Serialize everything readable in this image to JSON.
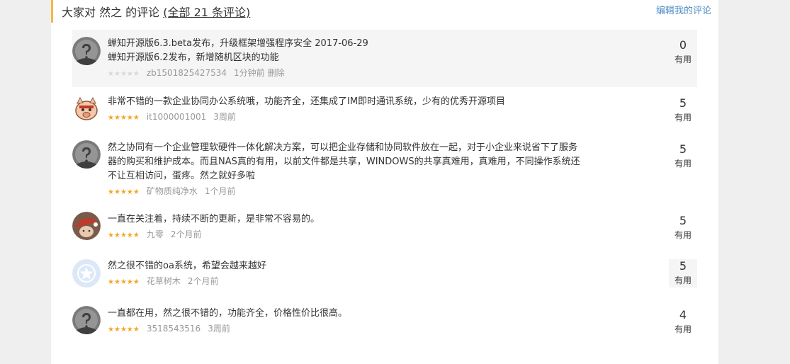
{
  "header": {
    "title_prefix": "大家对 然之 的评论",
    "count_link": "(全部 21 条评论)",
    "edit_link": "编辑我的评论"
  },
  "vote_label": "有用",
  "colors": {
    "star_on": "#f5a623",
    "star_off": "#d8d8d8",
    "accent_bar": "#f4b843",
    "link": "#4a8bc4"
  },
  "comments": [
    {
      "avatar": "default-avatar-icon",
      "lines": [
        "蝉知开源版6.3.beta发布，升级框架增强程序安全 2017-06-29",
        "蝉知开源版6.2发布，新增随机区块的功能"
      ],
      "rating": 0,
      "user": "zb1501825427534",
      "time": "1分钟前",
      "delete": "删除",
      "votes": "0",
      "highlight": true
    },
    {
      "avatar": "pig-avatar-icon",
      "lines": [
        "非常不错的一款企业协同办公系统哦，功能齐全，还集成了IM即时通讯系统，少有的优秀开源项目"
      ],
      "rating": 5,
      "user": "it1000001001",
      "time": "3周前",
      "votes": "5"
    },
    {
      "avatar": "default-avatar-icon",
      "lines": [
        "然之协同有一个企业管理软硬件一体化解决方案，可以把企业存储和协同软件放在一起，对于小企业来说省下了服务",
        "器的购买和维护成本。而且NAS真的有用，以前文件都是共享，WINDOWS的共享真难用，真难用，不同操作系统还",
        "不让互相访问，蛋疼。然之就好多啦"
      ],
      "rating": 5,
      "user": "矿物质纯净水",
      "time": "1个月前",
      "votes": "5"
    },
    {
      "avatar": "photo-avatar-icon",
      "lines": [
        "一直在关注着，持续不断的更新，是非常不容易的。"
      ],
      "rating": 5,
      "user": "九零",
      "time": "2个月前",
      "votes": "5"
    },
    {
      "avatar": "star-avatar-icon",
      "lines": [
        "然之很不错的oa系统，希望会越来越好"
      ],
      "rating": 5,
      "user": "花草树木",
      "time": "2个月前",
      "votes": "5",
      "vote_boxed": true
    },
    {
      "avatar": "default-avatar-icon",
      "lines": [
        "一直都在用，然之很不错的，功能齐全，价格性价比很高。"
      ],
      "rating": 5,
      "user": "3518543516",
      "time": "3周前",
      "votes": "4"
    }
  ]
}
